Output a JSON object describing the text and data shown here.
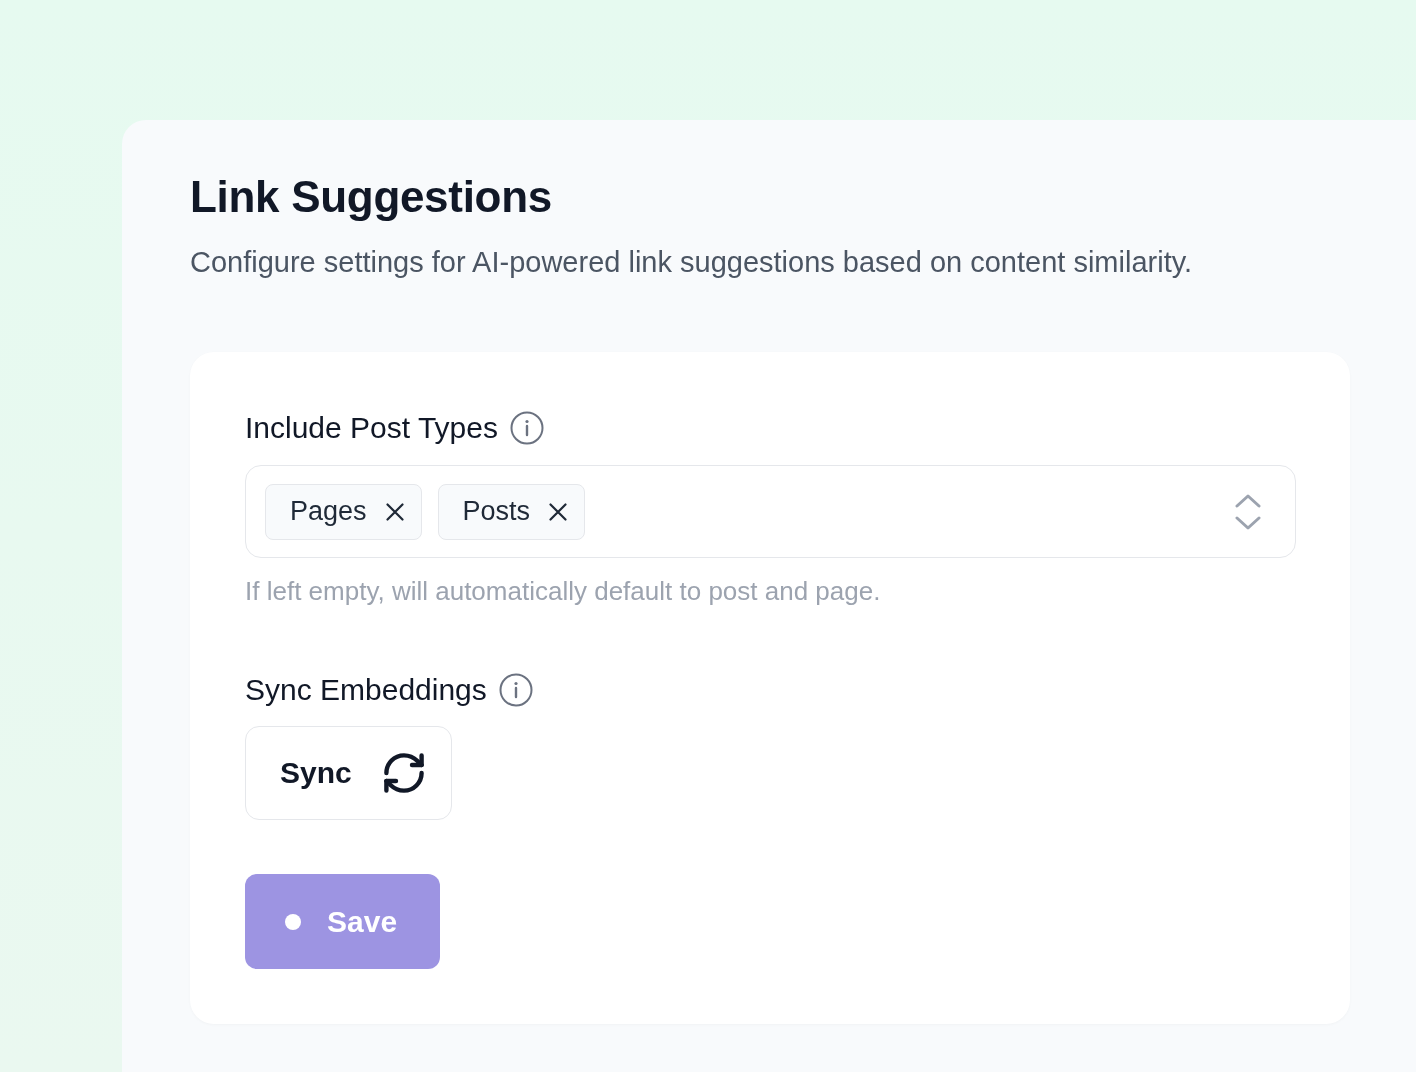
{
  "page": {
    "title": "Link Suggestions",
    "description": "Configure settings for AI-powered link suggestions based on content similarity."
  },
  "settings": [
    {
      "kind": "multiselect",
      "label": "Include Post Types",
      "info": true,
      "chips": [
        {
          "label": "Pages"
        },
        {
          "label": "Posts"
        }
      ],
      "help": "If left empty, will automatically default to post and page."
    },
    {
      "kind": "action",
      "label": "Sync Embeddings",
      "info": true,
      "button": {
        "label": "Sync"
      }
    }
  ],
  "save_button": {
    "label": "Save",
    "loading": true
  }
}
